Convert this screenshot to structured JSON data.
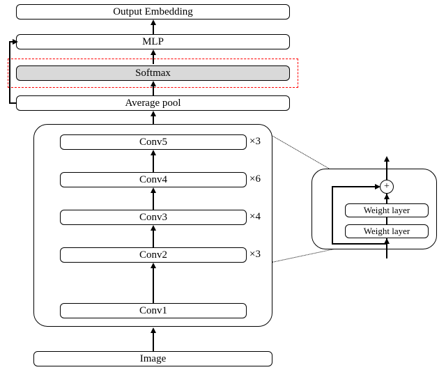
{
  "top": {
    "output": "Output Embedding",
    "mlp": "MLP",
    "softmax": "Softmax",
    "avgpool": "Average pool"
  },
  "backbone": {
    "conv5": "Conv5",
    "conv4": "Conv4",
    "conv3": "Conv3",
    "conv2": "Conv2",
    "conv1": "Conv1",
    "mult5": "×3",
    "mult4": "×6",
    "mult3": "×4",
    "mult2": "×3"
  },
  "bottom": {
    "image": "Image"
  },
  "residual": {
    "wl_top": "Weight layer",
    "wl_bottom": "Weight layer",
    "plus": "⊕"
  }
}
